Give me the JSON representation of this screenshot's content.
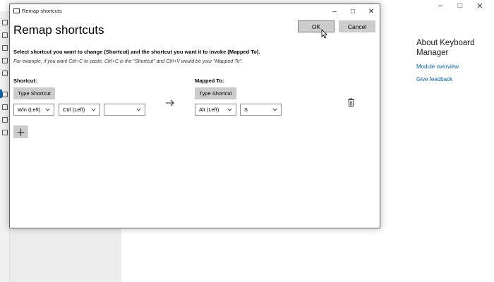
{
  "background": {
    "right_panel": {
      "title": "About Keyboard Manager",
      "links": [
        "Module overview",
        "Give feedback"
      ]
    },
    "window_controls": {
      "minimize": "–",
      "maximize": "□",
      "close": "✕"
    }
  },
  "dialog": {
    "titlebar_text": "Remap shortcuts",
    "heading": "Remap shortcuts",
    "ok_label": "OK",
    "cancel_label": "Cancel",
    "instruction": "Select shortcut you want to change (Shortcut) and the shortcut you want it to invoke (Mapped To).",
    "example": "For example, if you want Ctrl+C to paste, Ctrl+C is the \"Shortcut\" and Ctrl+V would be your \"Mapped To\".",
    "shortcut_label": "Shortcut:",
    "mapped_to_label": "Mapped To:",
    "type_shortcut_label": "Type Shortcut",
    "row": {
      "shortcut_keys": [
        "Win (Left)",
        "Ctrl (Left)",
        ""
      ],
      "mapped_keys": [
        "Alt (Left)",
        "S"
      ]
    },
    "window_controls": {
      "minimize": "–",
      "maximize": "□",
      "close": "✕"
    }
  },
  "colors": {
    "accent": "#0063b1",
    "button_gray": "#cccccc"
  },
  "icons": [
    "arrow-right-icon",
    "trash-icon",
    "plus-icon",
    "chevron-down-icon",
    "cursor-icon"
  ]
}
